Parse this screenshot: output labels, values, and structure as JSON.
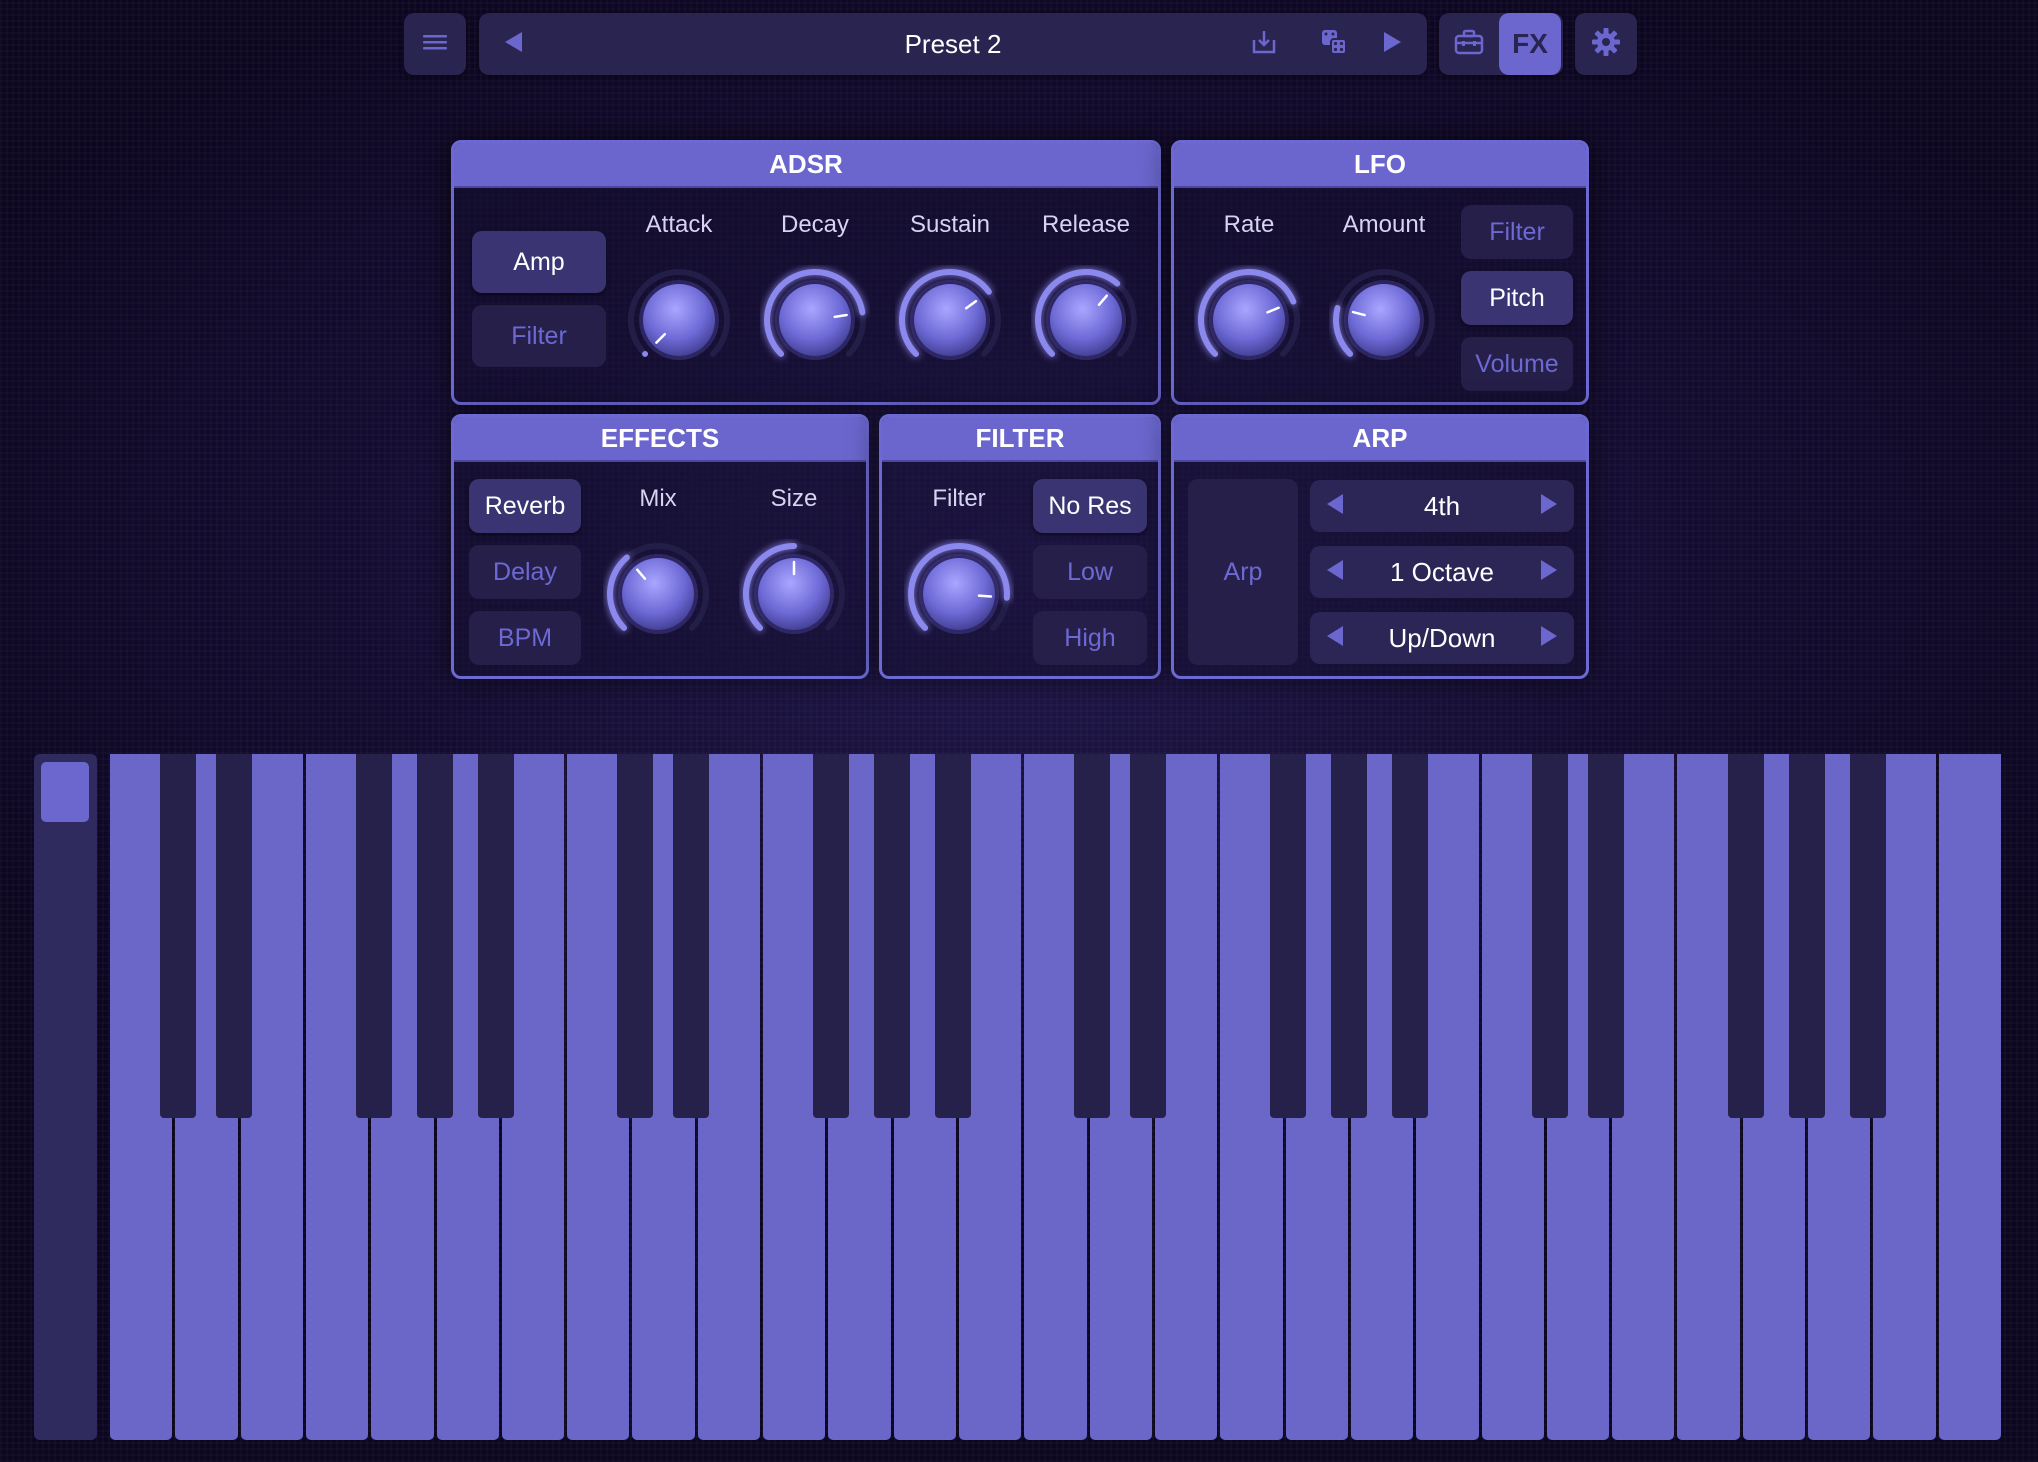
{
  "toolbar": {
    "preset_name": "Preset 2",
    "fx_label": "FX",
    "icons": [
      "menu-icon",
      "prev-preset-icon",
      "save-icon",
      "dice-icon",
      "next-preset-icon",
      "toolbox-icon",
      "gear-icon"
    ]
  },
  "adsr": {
    "title": "ADSR",
    "modes": [
      {
        "label": "Amp",
        "active": true
      },
      {
        "label": "Filter",
        "active": false
      }
    ],
    "knobs": [
      {
        "label": "Attack",
        "value": 0.0
      },
      {
        "label": "Decay",
        "value": 0.8
      },
      {
        "label": "Sustain",
        "value": 0.7
      },
      {
        "label": "Release",
        "value": 0.65
      }
    ]
  },
  "lfo": {
    "title": "LFO",
    "knobs": [
      {
        "label": "Rate",
        "value": 0.75
      },
      {
        "label": "Amount",
        "value": 0.22
      }
    ],
    "targets": [
      {
        "label": "Filter",
        "active": false
      },
      {
        "label": "Pitch",
        "active": true
      },
      {
        "label": "Volume",
        "active": false
      }
    ]
  },
  "effects": {
    "title": "EFFECTS",
    "types": [
      {
        "label": "Reverb",
        "active": true
      },
      {
        "label": "Delay",
        "active": false
      },
      {
        "label": "BPM",
        "active": false
      }
    ],
    "knobs": [
      {
        "label": "Mix",
        "value": 0.35
      },
      {
        "label": "Size",
        "value": 0.5
      }
    ]
  },
  "filter": {
    "title": "FILTER",
    "knob": {
      "label": "Filter",
      "value": 0.85
    },
    "modes": [
      {
        "label": "No Res",
        "active": true
      },
      {
        "label": "Low",
        "active": false
      },
      {
        "label": "High",
        "active": false
      }
    ]
  },
  "arp": {
    "title": "ARP",
    "toggle_label": "Arp",
    "rows": [
      {
        "value": "4th"
      },
      {
        "value": "1 Octave"
      },
      {
        "value": "Up/Down"
      }
    ]
  },
  "keyboard": {
    "white_keys": 29,
    "pitch_wheel_level": 0.0
  },
  "colors": {
    "accent": "#6b67cf",
    "panel_border": "#6d69d2",
    "button_on": "#3a3572",
    "button_off_text": "#6d69d2",
    "black_key": "#25214a",
    "background": "#0e0722"
  }
}
